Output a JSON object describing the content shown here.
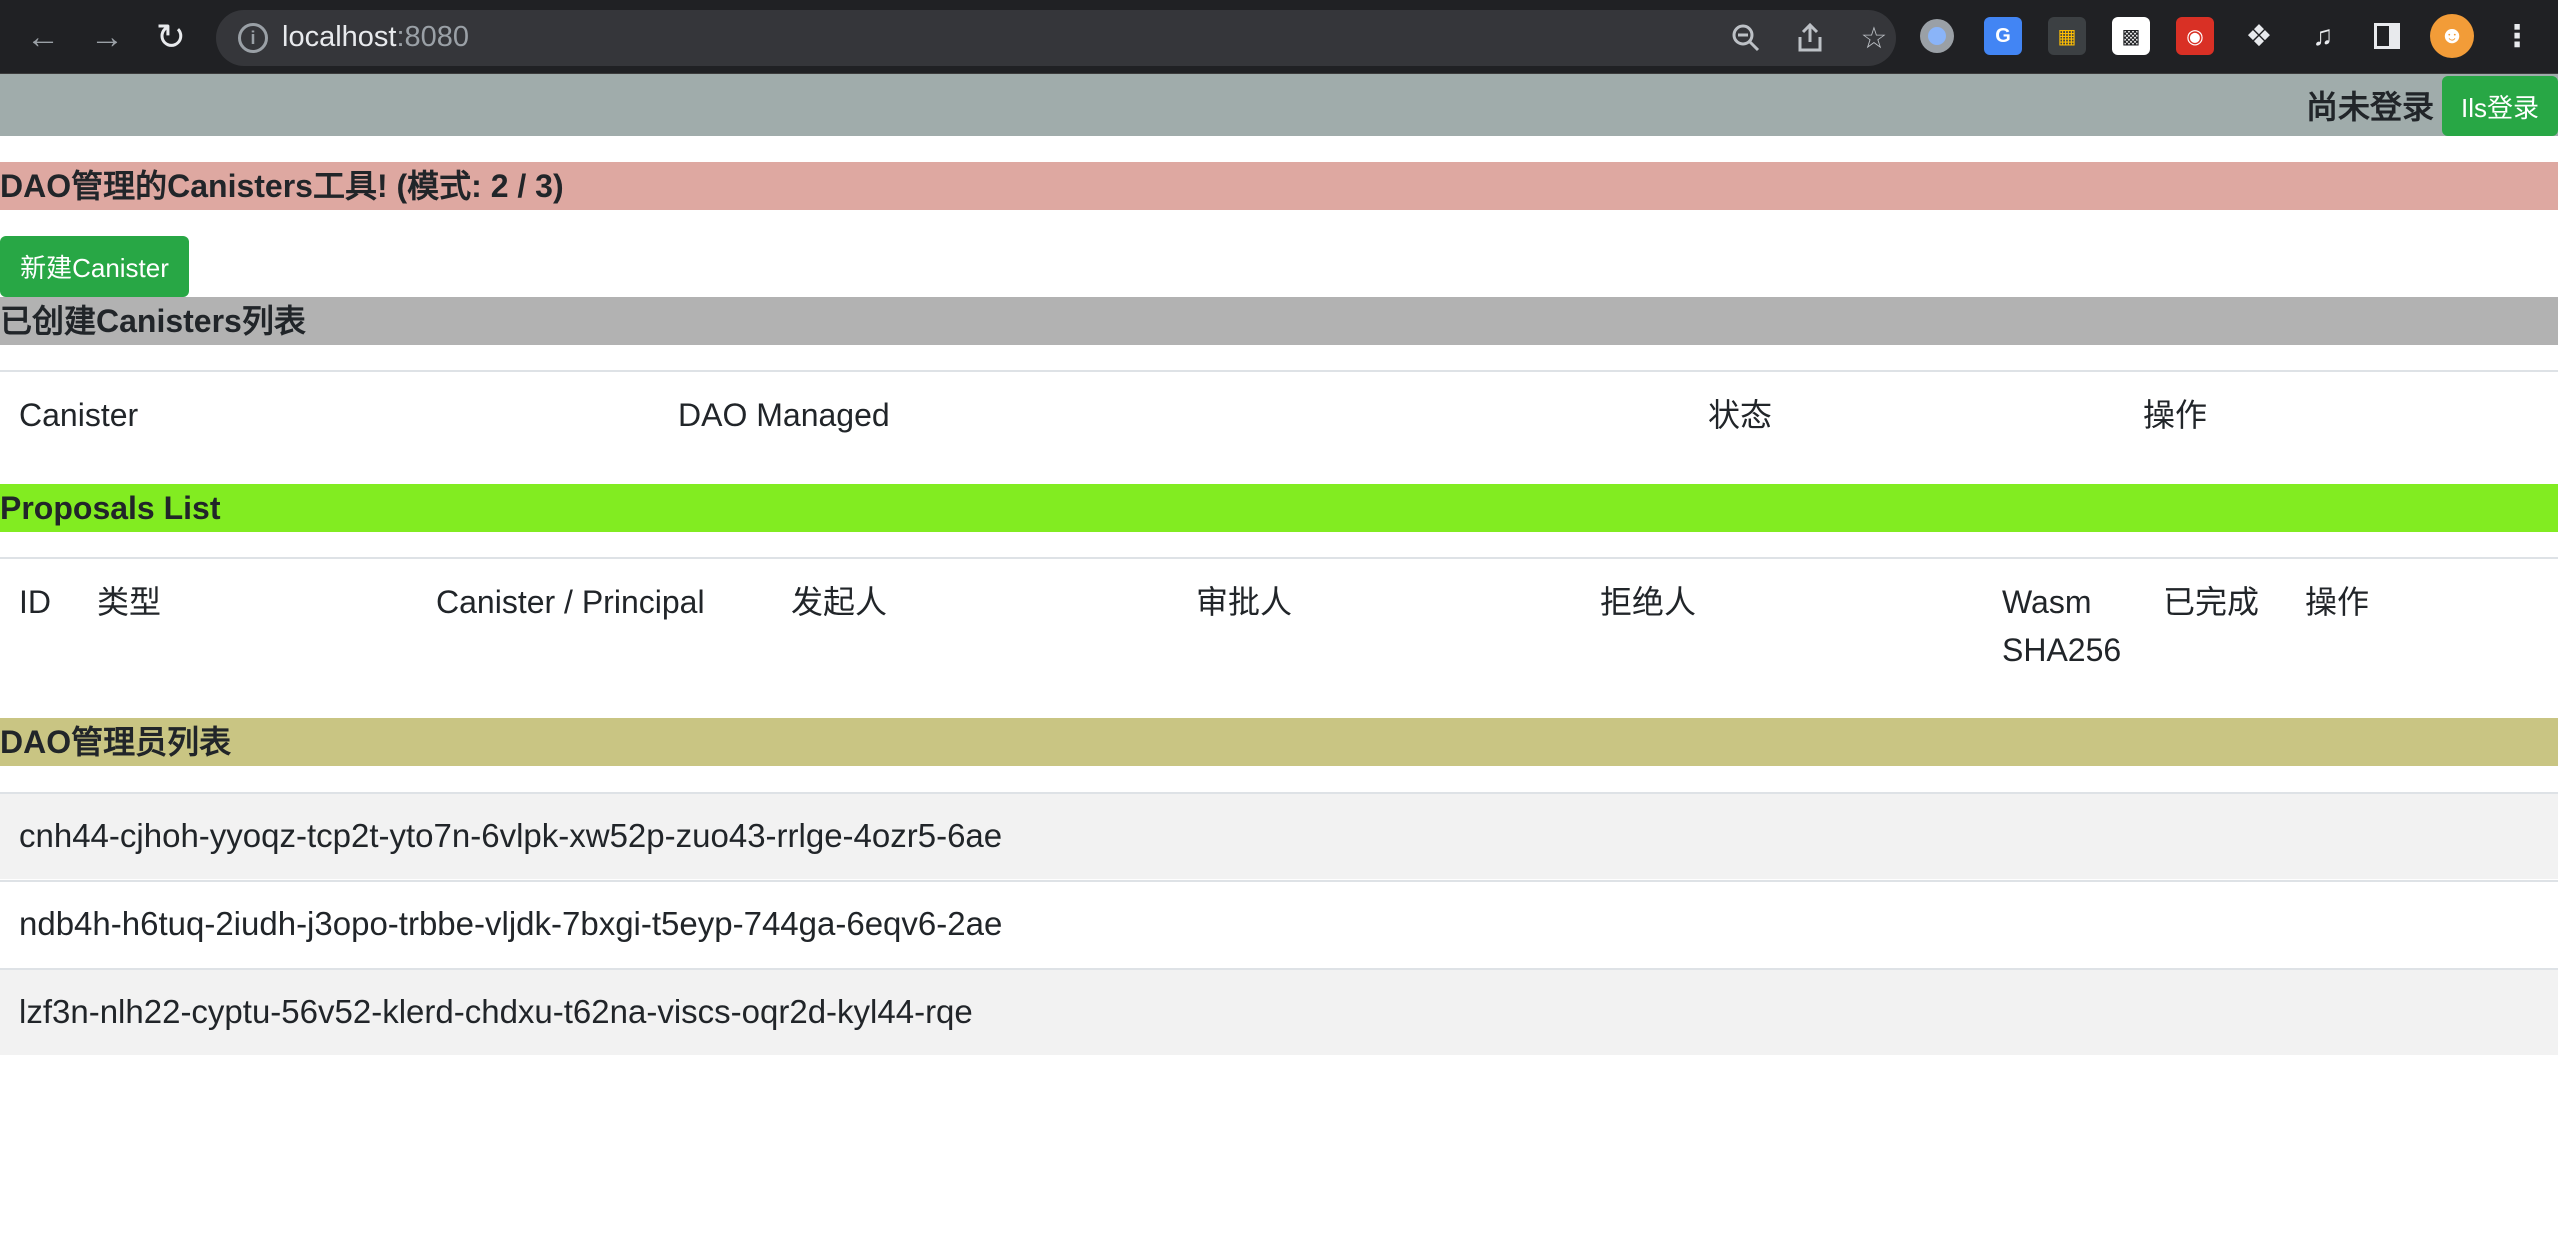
{
  "browser": {
    "url_host": "localhost",
    "url_port": ":8080",
    "back_icon": "arrow-left-icon",
    "forward_icon": "arrow-right-icon",
    "reload_icon": "reload-icon",
    "info_icon": "info-icon",
    "zoom_icon": "zoom-out-icon",
    "share_icon": "share-icon",
    "bookmark_icon": "star-icon",
    "extensions": [
      "circle-ext-icon",
      "translate-ext-icon",
      "grid-ext-icon",
      "qr-ext-icon",
      "paw-ext-icon",
      "puzzle-icon",
      "media-queue-icon",
      "sidepanel-icon",
      "avatar-icon",
      "more-icon"
    ]
  },
  "header": {
    "login_status": "尚未登录",
    "login_button": "Ils登录"
  },
  "title": {
    "text": "DAO管理的Canisters工具! (模式: 2 / 3)"
  },
  "actions": {
    "create_canister": "新建Canister"
  },
  "canisters": {
    "heading": "已创建Canisters列表",
    "columns": [
      "Canister",
      "DAO Managed",
      "状态",
      "操作"
    ]
  },
  "proposals": {
    "heading": "Proposals List",
    "columns": [
      "ID",
      "类型",
      "Canister / Principal",
      "发起人",
      "审批人",
      "拒绝人",
      "Wasm SHA256",
      "已完成",
      "操作"
    ],
    "wasm_line1": "Wasm",
    "wasm_line2": "SHA256"
  },
  "admins": {
    "heading": "DAO管理员列表",
    "rows": [
      "cnh44-cjhoh-yyoqz-tcp2t-yto7n-6vlpk-xw52p-zuo43-rrlge-4ozr5-6ae",
      "ndb4h-h6tuq-2iudh-j3opo-trbbe-vljdk-7bxgi-t5eyp-744ga-6eqv6-2ae",
      "lzf3n-nlh22-cyptu-56v52-klerd-chdxu-t62na-viscs-oqr2d-kyl44-rqe"
    ]
  },
  "colors": {
    "topbar": "#a0acab",
    "title_bar": "#dea8a1",
    "canisters_bar": "#b2b2b2",
    "proposals_bar": "#82ec21",
    "admins_bar": "#c9c583",
    "success": "#28a745"
  }
}
